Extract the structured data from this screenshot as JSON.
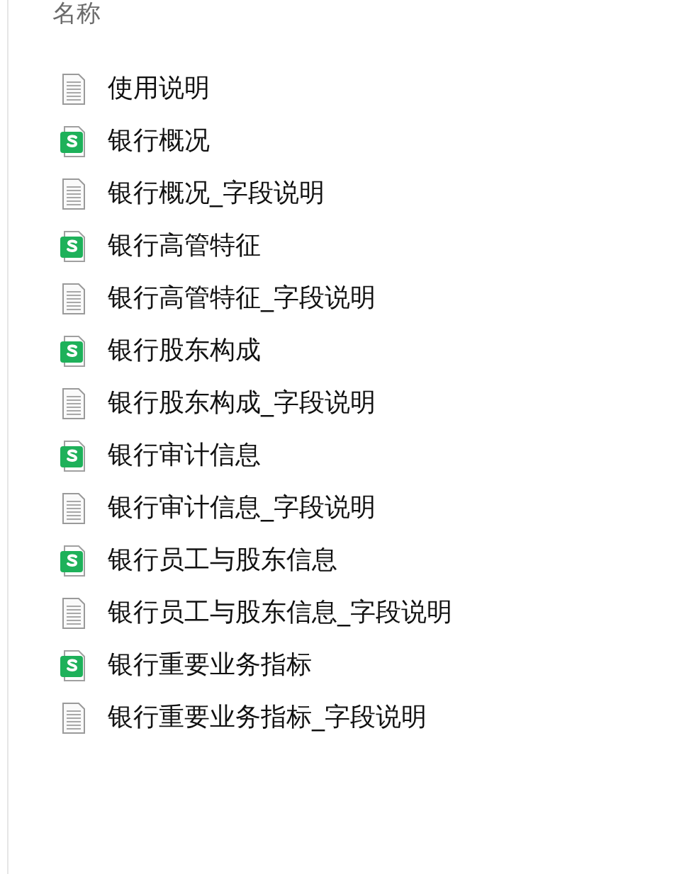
{
  "header": {
    "label": "名称"
  },
  "files": [
    {
      "name": "使用说明",
      "kind": "text"
    },
    {
      "name": "银行概况",
      "kind": "sheet"
    },
    {
      "name": "银行概况_字段说明",
      "kind": "text"
    },
    {
      "name": "银行高管特征",
      "kind": "sheet"
    },
    {
      "name": "银行高管特征_字段说明",
      "kind": "text"
    },
    {
      "name": "银行股东构成",
      "kind": "sheet"
    },
    {
      "name": "银行股东构成_字段说明",
      "kind": "text"
    },
    {
      "name": "银行审计信息",
      "kind": "sheet"
    },
    {
      "name": "银行审计信息_字段说明",
      "kind": "text"
    },
    {
      "name": "银行员工与股东信息",
      "kind": "sheet"
    },
    {
      "name": "银行员工与股东信息_字段说明",
      "kind": "text"
    },
    {
      "name": "银行重要业务指标",
      "kind": "sheet"
    },
    {
      "name": "银行重要业务指标_字段说明",
      "kind": "text"
    }
  ]
}
